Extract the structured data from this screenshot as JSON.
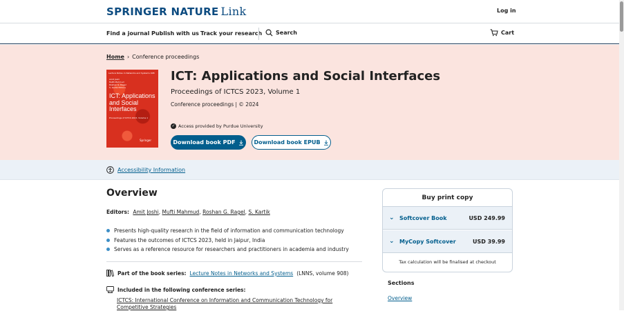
{
  "header": {
    "brand": "SPRINGER NATURE",
    "brand_link": "Link",
    "login": "Log in"
  },
  "nav": {
    "find_journal": "Find a journal",
    "publish": "Publish with us",
    "track": "Track your research",
    "search": "Search",
    "cart": "Cart"
  },
  "breadcrumb": {
    "home": "Home",
    "separator": "›",
    "current": "Conference proceedings"
  },
  "cover": {
    "series_line": "Lecture Notes in Networks and Systems 908",
    "authors": [
      "Amit Joshi",
      "Mufti Mahmud",
      "Roshan G. Ragel",
      "S. Kartik  Editors"
    ],
    "title": "ICT: Applications and Social Interfaces",
    "subtitle": "Proceedings of ICTCS 2023, Volume 1",
    "publisher": "Springer"
  },
  "book": {
    "title": "ICT: Applications and Social Interfaces",
    "subtitle": "Proceedings of ICTCS 2023, Volume 1",
    "meta": "Conference proceedings | © 2024",
    "access": "Access provided by Purdue University",
    "download_pdf": "Download book PDF",
    "download_epub": "Download book EPUB"
  },
  "accessibility": {
    "link": "Accessibility Information"
  },
  "overview": {
    "heading": "Overview",
    "editors_label": "Editors:",
    "editors": [
      "Amit Joshi",
      "Mufti Mahmud",
      "Roshan G. Ragel",
      "S. Kartik"
    ],
    "bullets": [
      "Presents high-quality research in the field of information and communication technology",
      "Features the outcomes of ICTCS 2023, held in Jaipur, India",
      "Serves as a reference resource for researchers and practitioners in academia and industry"
    ],
    "series_label": "Part of the book series:",
    "series_link": "Lecture Notes in Networks and Systems",
    "series_suffix": "(LNNS, volume 908)",
    "conf_label": "Included in the following conference series:",
    "conf_link": "ICTCS: International Conference on Information and Communication Technology for Competitive Strategies"
  },
  "buybox": {
    "heading": "Buy print copy",
    "options": [
      {
        "name": "Softcover Book",
        "price": "USD 249.99"
      },
      {
        "name": "MyCopy Softcover",
        "price": "USD 39.99"
      }
    ],
    "tax_note": "Tax calculation will be finalised at checkout"
  },
  "sections": {
    "heading": "Sections",
    "first": "Overview"
  },
  "colors": {
    "accent": "#025e8d",
    "brand": "#0c4b80",
    "hero_bg": "#fbe4df",
    "access_bar_bg": "#ebf1f7",
    "bullet": "#3c8ec6"
  }
}
